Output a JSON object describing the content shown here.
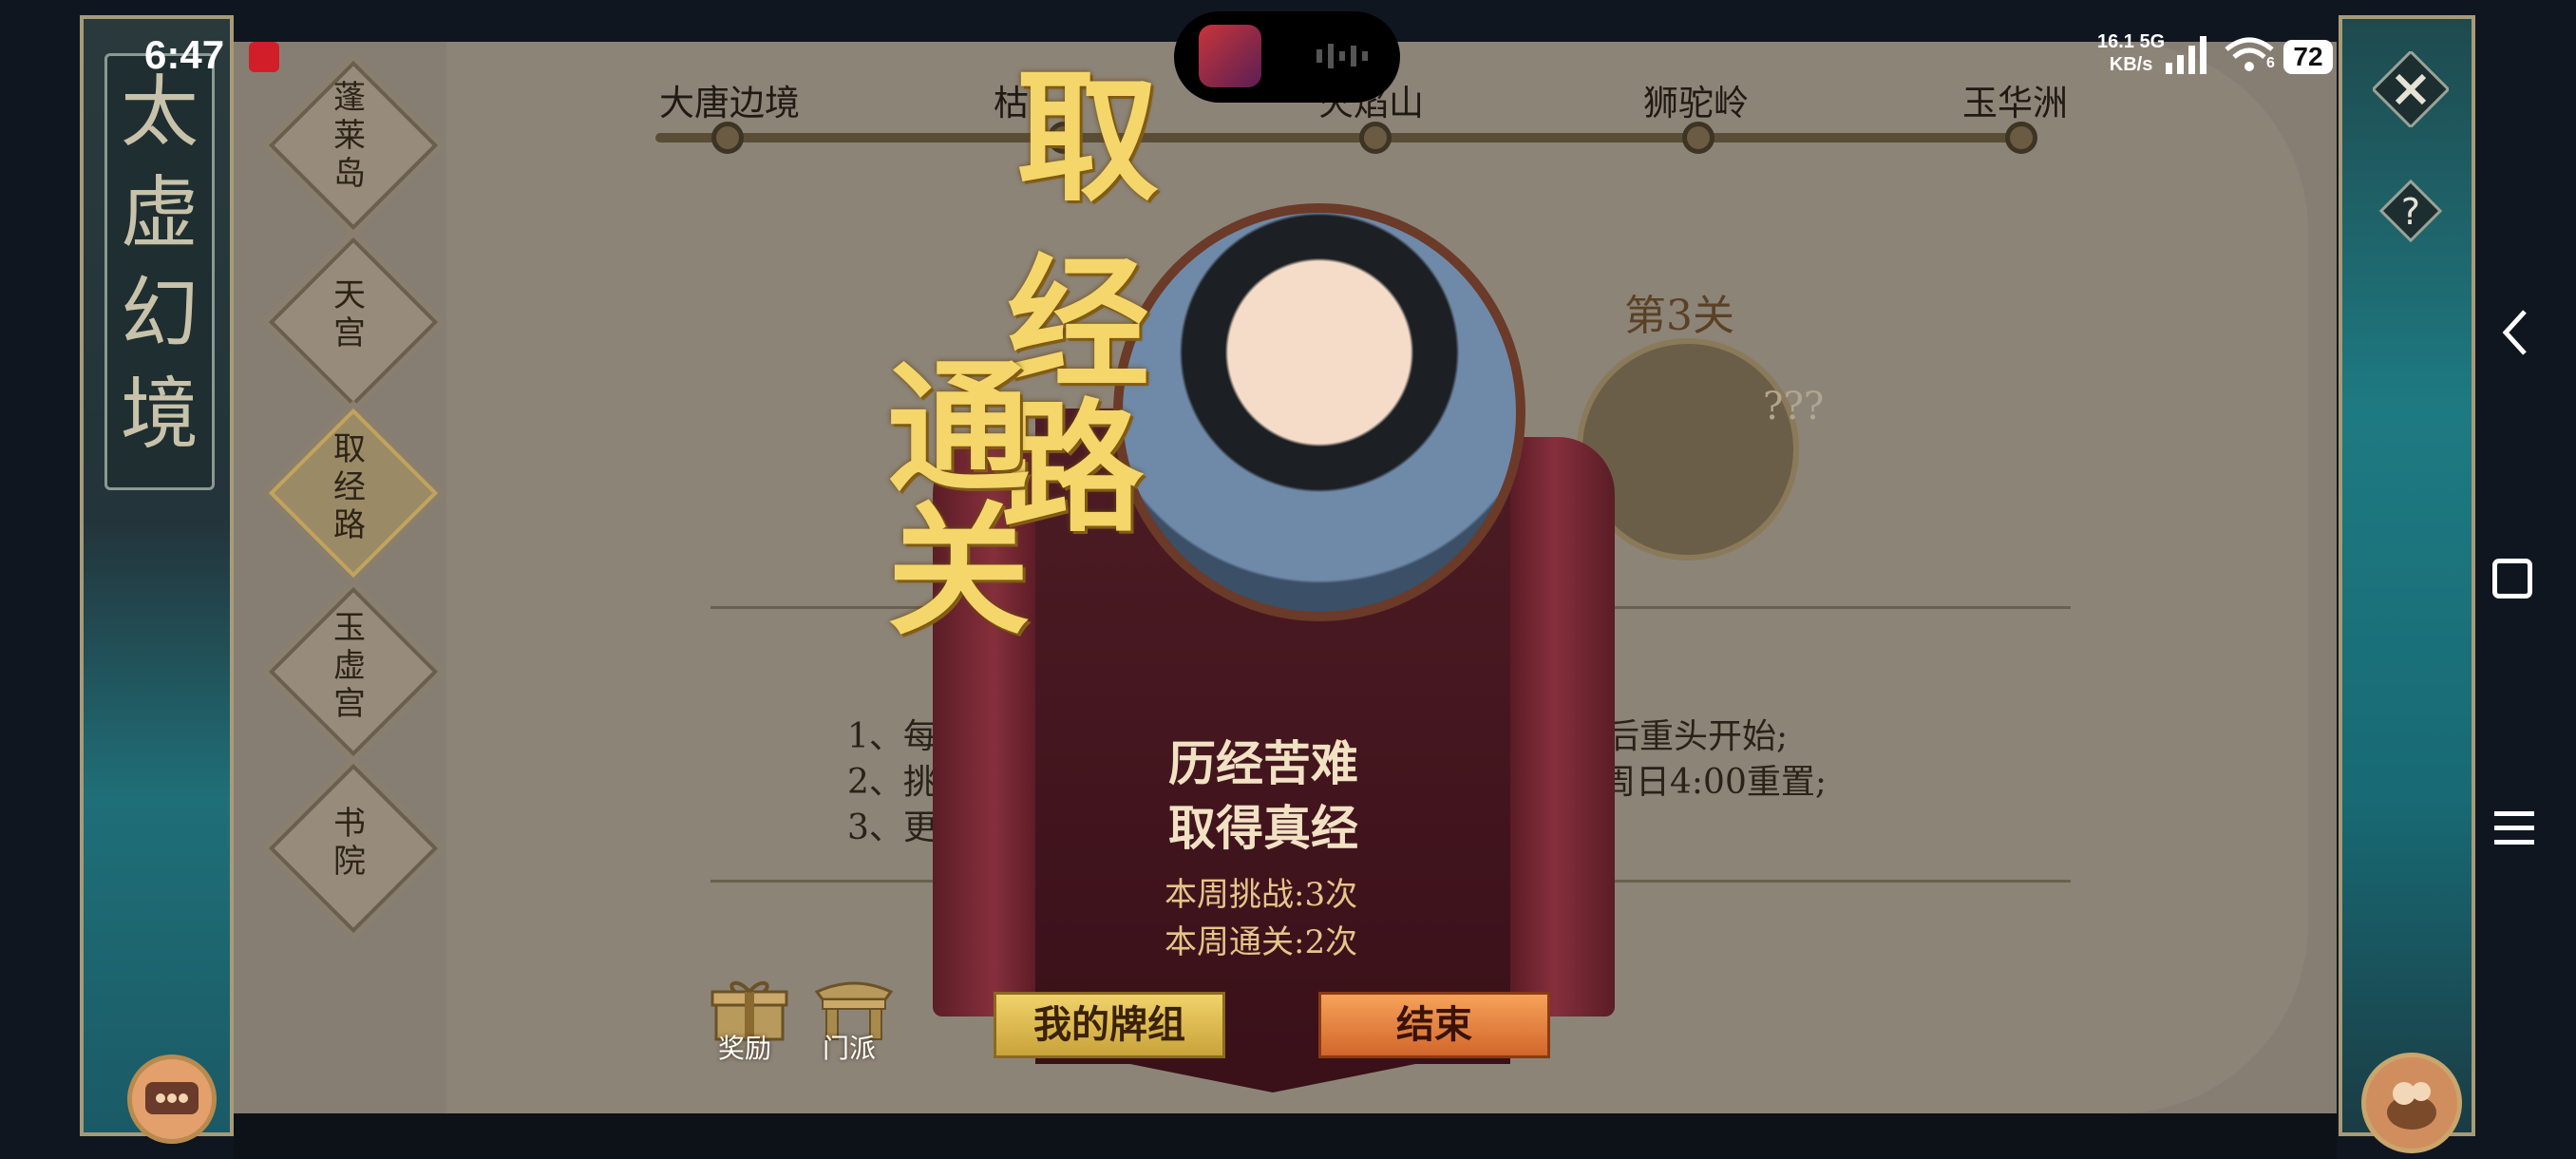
{
  "status_bar": {
    "time": "6:47",
    "net_speed": "16.1",
    "net_speed_unit": "KB/s",
    "net_type": "5G",
    "wifi_badge": "6",
    "battery": "72"
  },
  "left_rail": {
    "title_chars": [
      "太",
      "虚",
      "幻",
      "境"
    ],
    "menu": [
      {
        "label": [
          "蓬",
          "莱",
          "岛"
        ],
        "active": false
      },
      {
        "label": [
          "天",
          "宫"
        ],
        "active": false
      },
      {
        "label": [
          "取",
          "经",
          "路"
        ],
        "active": true
      },
      {
        "label": [
          "玉",
          "虚",
          "宫"
        ],
        "active": false
      },
      {
        "label": [
          "书",
          "院"
        ],
        "active": false
      }
    ]
  },
  "stages": {
    "track": [
      "大唐边境",
      "枯",
      "火焰山",
      "狮驼岭",
      "玉华洲"
    ],
    "stage3_title": "第3关",
    "stage3_hint": "???"
  },
  "rules": [
    "1、每关",
    "后重头开始;",
    "2、挑战",
    "每周日4:00重置;",
    "3、更多",
    "。"
  ],
  "bottom_icons": {
    "reward": "奖励",
    "faction": "门派"
  },
  "banner": {
    "calligraphy": [
      "取",
      "经",
      "路",
      "通",
      "关"
    ],
    "line1": "历经苦难",
    "line2": "取得真经",
    "weekly_challenge": "本周挑战:3次",
    "weekly_clear": "本周通关:2次",
    "deck_button": "我的牌组",
    "end_button": "结束"
  },
  "colors": {
    "gold_text": "#f5d66a",
    "banner_maroon": "#4e1c25",
    "deck_button": "#f1d26a",
    "end_button": "#f6a259"
  },
  "icons": {
    "close": "close-icon",
    "help": "question-icon",
    "chat": "chat-icon",
    "pet": "pet-icon",
    "reward": "gift-icon",
    "faction": "gate-icon"
  }
}
